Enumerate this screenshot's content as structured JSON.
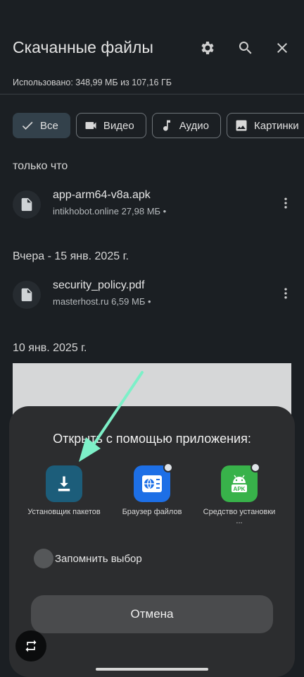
{
  "header": {
    "title": "Скачанные файлы",
    "usage": "Использовано: 348,99 МБ из 107,16 ГБ",
    "icons": [
      "gear-icon",
      "search-icon",
      "close-icon"
    ]
  },
  "filters": [
    {
      "label": "Все",
      "icon": "check-icon",
      "active": true
    },
    {
      "label": "Видео",
      "icon": "video-icon",
      "active": false
    },
    {
      "label": "Аудио",
      "icon": "music-icon",
      "active": false
    },
    {
      "label": "Картинки",
      "icon": "image-icon",
      "active": false
    }
  ],
  "sections": [
    {
      "header": "только что",
      "files": [
        {
          "name": "app-arm64-v8a.apk",
          "meta": "intikhobot.online 27,98 МБ •"
        }
      ]
    },
    {
      "header": "Вчера - 15 янв. 2025 г.",
      "files": [
        {
          "name": "security_policy.pdf",
          "meta": "masterhost.ru 6,59 МБ •"
        }
      ]
    },
    {
      "header": "10 янв. 2025 г.",
      "files": []
    }
  ],
  "sheet": {
    "title": "Открыть с помощью приложения:",
    "apps": [
      {
        "label": "Установщик пакетов",
        "icon": "download-icon",
        "color": "#1c5d7a"
      },
      {
        "label": "Браузер файлов",
        "icon": "file-browser-icon",
        "color": "#1d6fe6"
      },
      {
        "label": "Средство установки ...",
        "icon": "apk-installer-icon",
        "color": "#38b24a",
        "icon_text": "APK"
      }
    ],
    "remember_label": "Запомнить выбор",
    "cancel_label": "Отмена"
  },
  "colors": {
    "background": "#1b1f23",
    "sheet": "#2c2d2f",
    "arrow": "#7df0c8"
  }
}
